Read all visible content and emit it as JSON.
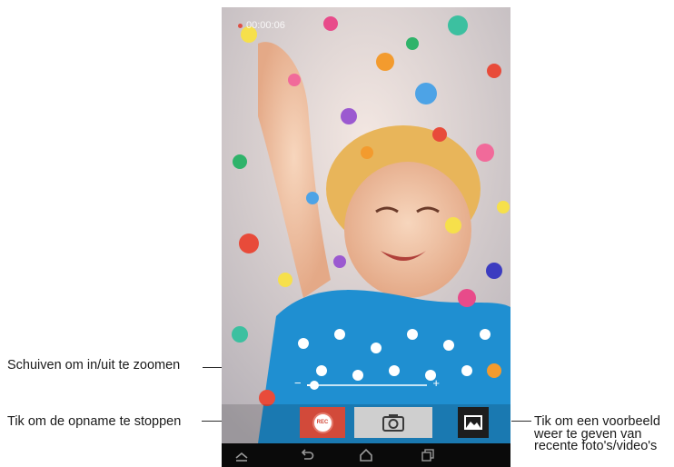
{
  "callouts": {
    "zoom": "Schuiven om in/uit te zoomen",
    "stop": "Tik om de opname te stoppen",
    "preview_line1": "Tik om een voorbeeld",
    "preview_line2": "weer te geven van",
    "preview_line3": "recente foto's/video's"
  },
  "camera": {
    "timer": "00:00:06",
    "zoom_minus": "−",
    "zoom_plus": "+",
    "zoom_level": 0.06,
    "rec_label": "REC"
  },
  "icons": {
    "rec": "record-icon",
    "shutter": "camera-icon",
    "gallery": "image-icon",
    "nav_back": "back-icon",
    "nav_home": "home-icon",
    "nav_recent": "recent-apps-icon",
    "nav_up": "chevron-up-icon"
  },
  "colors": {
    "rec_button": "#d24a3a",
    "shutter_button": "#cfcfcf",
    "navbar": "#0a0a0a"
  }
}
